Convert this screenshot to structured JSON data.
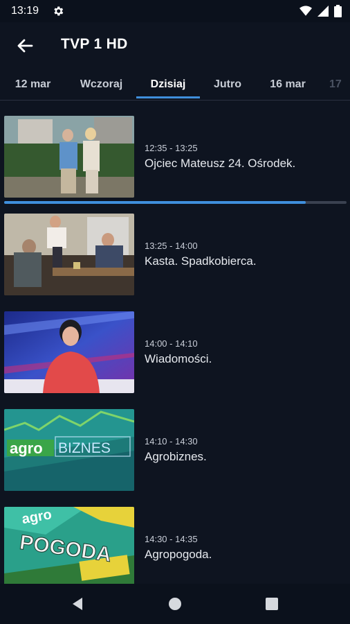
{
  "status_bar": {
    "time": "13:19",
    "icons": [
      "gear-icon",
      "wifi-icon",
      "signal-icon",
      "battery-icon"
    ]
  },
  "app_bar": {
    "back_icon": "arrow-left-icon",
    "title": "TVP 1 HD"
  },
  "tabs": [
    {
      "label": "12 mar",
      "active": false
    },
    {
      "label": "Wczoraj",
      "active": false
    },
    {
      "label": "Dzisiaj",
      "active": true
    },
    {
      "label": "Jutro",
      "active": false
    },
    {
      "label": "16 mar",
      "active": false
    },
    {
      "label": "17",
      "active": false
    }
  ],
  "programs": [
    {
      "time": "12:35 - 13:25",
      "title": "Ojciec Mateusz 24. Ośrodek.",
      "progress": 0.88
    },
    {
      "time": "13:25 - 14:00",
      "title": "Kasta. Spadkobierca."
    },
    {
      "time": "14:00 - 14:10",
      "title": "Wiadomości."
    },
    {
      "time": "14:10 - 14:30",
      "title": "Agrobiznes."
    },
    {
      "time": "14:30 - 14:35",
      "title": "Agropogoda."
    }
  ],
  "thumb_text": {
    "agro_a": "agro",
    "agro_b": "BIZNES",
    "pogoda_a": "agro",
    "pogoda_b": "POGODA"
  },
  "colors": {
    "background": "#0e1420",
    "accent": "#3f8fdc"
  },
  "nav_bar": {
    "icons": [
      "back-triangle-icon",
      "home-circle-icon",
      "recents-square-icon"
    ]
  }
}
